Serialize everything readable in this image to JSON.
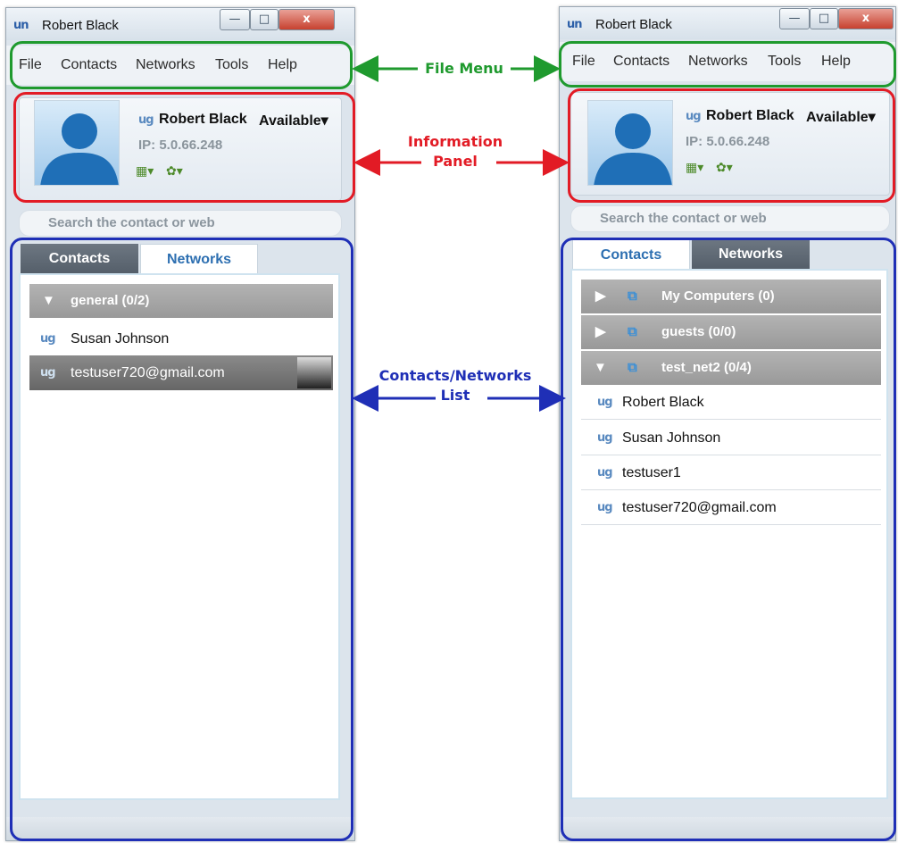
{
  "left_window": {
    "title": "Robert Black",
    "menu": [
      "File",
      "Contacts",
      "Networks",
      "Tools",
      "Help"
    ],
    "user_name": "Robert Black",
    "status": "Available",
    "ip": "IP: 5.0.66.248",
    "search_placeholder": "Search the contact or web",
    "tabs": [
      "Contacts",
      "Networks"
    ],
    "group": "general (0/2)",
    "contacts": [
      "Susan Johnson",
      "testuser720@gmail.com"
    ]
  },
  "right_window": {
    "title": "Robert Black",
    "menu": [
      "File",
      "Contacts",
      "Networks",
      "Tools",
      "Help"
    ],
    "user_name": "Robert Black",
    "status": "Available",
    "ip": "IP: 5.0.66.248",
    "search_placeholder": "Search the contact or web",
    "tabs": [
      "Contacts",
      "Networks"
    ],
    "groups": [
      "My Computers (0)",
      "guests (0/0)",
      "test_net2 (0/4)"
    ],
    "contacts": [
      "Robert Black",
      "Susan Johnson",
      "testuser1",
      "testuser720@gmail.com"
    ]
  },
  "annotations": {
    "file_menu": "File Menu",
    "info_panel": "Information\nPanel",
    "contacts_list": "Contacts/Networks\nList",
    "green": "#1f9a2e",
    "red": "#e21b25",
    "blue": "#1f2fb6"
  }
}
